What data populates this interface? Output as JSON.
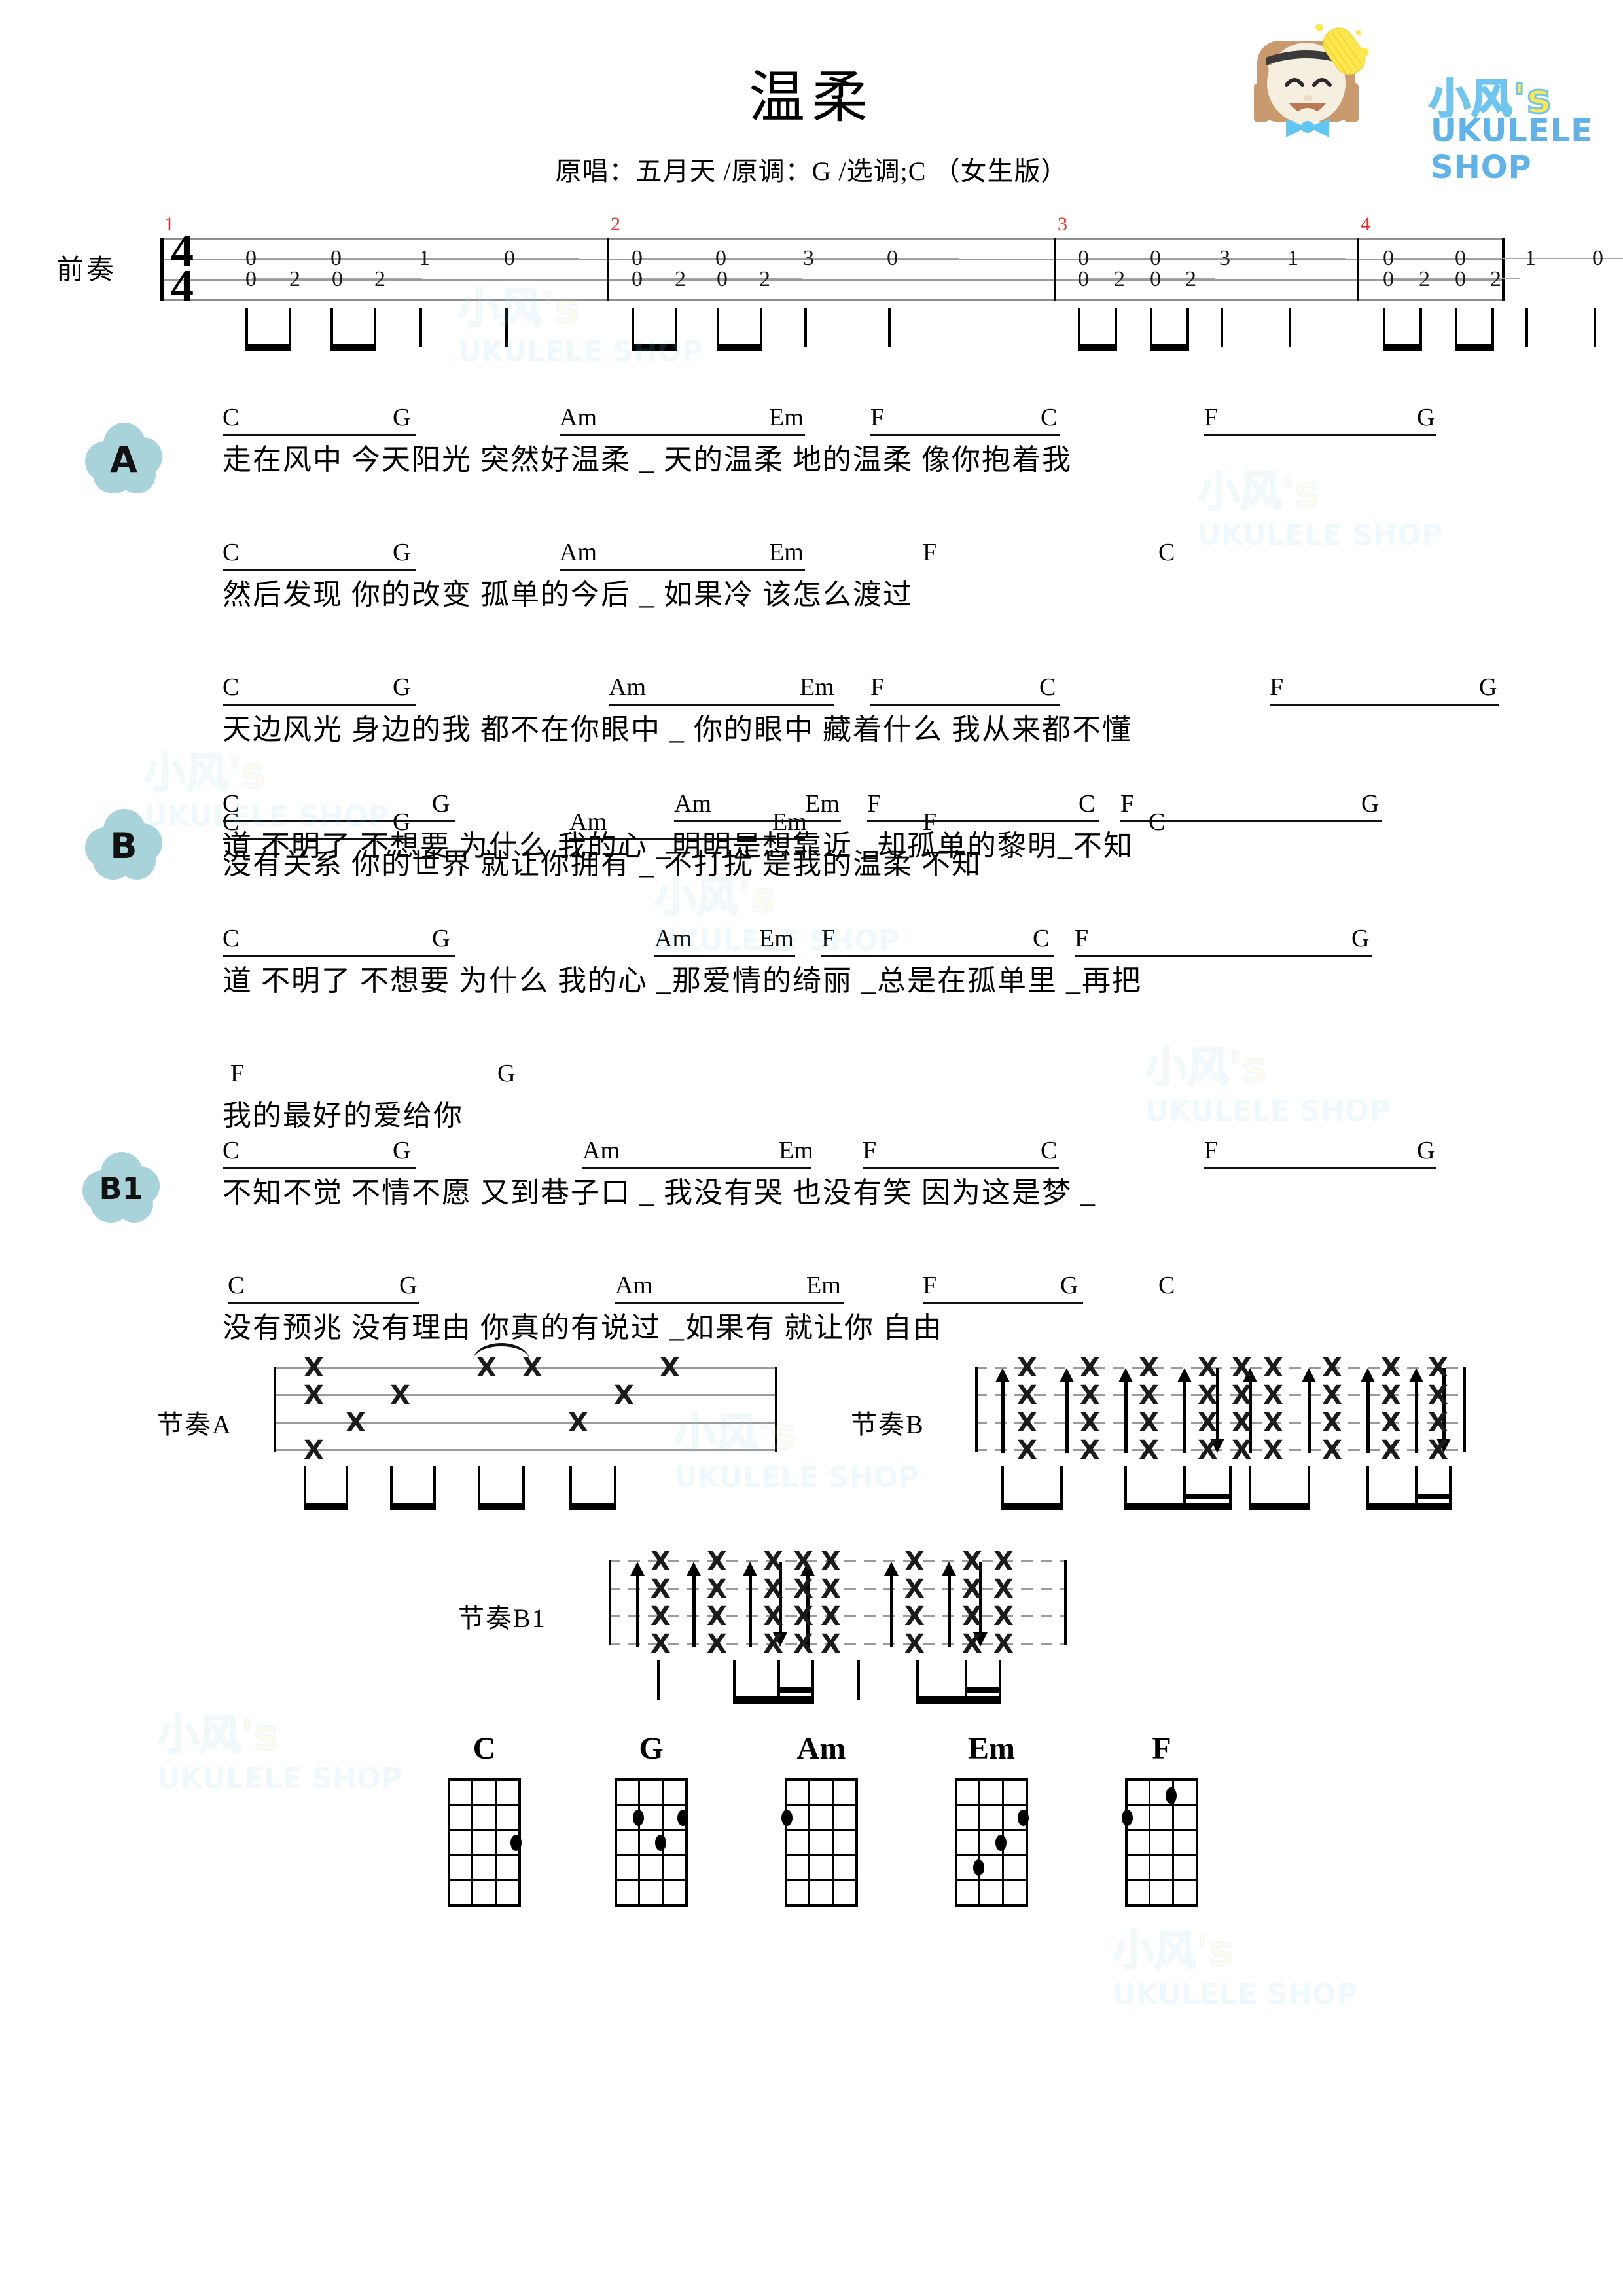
{
  "header": {
    "title": "温柔",
    "subtitle": "原唱：五月天  /原调：G  /选调;C  （女生版）"
  },
  "logo": {
    "brand_cn": "小风's",
    "brand_en": "UKULELE SHOP",
    "icon": "girl-avatar-icon"
  },
  "prelude": {
    "label": "前奏",
    "time_signature": "4/4",
    "measure_numbers": [
      "1",
      "2",
      "3",
      "4"
    ],
    "measures": [
      {
        "num": "1",
        "upper": [
          "0",
          "0",
          "1",
          "0"
        ],
        "lower": [
          "0",
          "2",
          "0",
          "2"
        ]
      },
      {
        "num": "2",
        "upper": [
          "0",
          "0",
          "3",
          "0"
        ],
        "lower": [
          "0",
          "2",
          "0",
          "2"
        ]
      },
      {
        "num": "3",
        "upper": [
          "0",
          "0",
          "3",
          "1"
        ],
        "lower": [
          "0",
          "2",
          "0",
          "2"
        ]
      },
      {
        "num": "4",
        "upper": [
          "0",
          "0",
          "1",
          "0"
        ],
        "lower": [
          "0",
          "2",
          "0",
          "2"
        ]
      }
    ]
  },
  "sections": [
    {
      "marker": "A",
      "lines": [
        {
          "chords": [
            "C",
            "G",
            "Am",
            "Em",
            "F",
            "C",
            "F",
            "G"
          ],
          "lyrics": "走在风中 今天阳光 突然好温柔  _     天的温柔 地的温柔 像你抱着我"
        },
        {
          "chords": [
            "C",
            "G",
            "Am",
            "Em",
            "F",
            "C"
          ],
          "lyrics": "然后发现 你的改变 孤单的今后  _   如果冷 该怎么渡过"
        },
        {
          "chords": [
            "C",
            "G",
            "Am",
            "Em",
            "F",
            "C",
            "F",
            "G"
          ],
          "lyrics": "天边风光 身边的我 都不在你眼中 _  你的眼中 藏着什么 我从来都不懂"
        },
        {
          "chords": [
            "C",
            "G",
            "Am",
            "Em",
            "F",
            "C"
          ],
          "lyrics": "没有关系 你的世界 就让你拥有  _   不打扰 是我的温柔    不知"
        }
      ]
    },
    {
      "marker": "B",
      "lines": [
        {
          "chords": [
            "C",
            "G",
            "Am",
            "Em",
            "F",
            "C",
            "F",
            "G"
          ],
          "lyrics": "道 不明了 不想要 为什么 我的心  _明明是想靠近  _却孤单的黎明_不知"
        },
        {
          "chords": [
            "C",
            "G",
            "Am",
            "Em",
            "F",
            "C",
            "F",
            "G"
          ],
          "lyrics": "道 不明了 不想要 为什么 我的心 _那爱情的绮丽 _总是在孤单里 _再把"
        },
        {
          "chords": [
            "F",
            "G"
          ],
          "lyrics": "我的最好的爱给你"
        }
      ]
    },
    {
      "marker": "B1",
      "lines": [
        {
          "chords": [
            "C",
            "G",
            "Am",
            "Em",
            "F",
            "C",
            "F",
            "G"
          ],
          "lyrics": "不知不觉 不情不愿 又到巷子口  _   我没有哭 也没有笑 因为这是梦  _"
        },
        {
          "chords": [
            "C",
            "G",
            "Am",
            "Em",
            "F",
            "G",
            "C"
          ],
          "lyrics": "没有预兆 没有理由 你真的有说过 _如果有 就让你 自由"
        }
      ]
    }
  ],
  "rhythms": [
    {
      "label": "节奏A",
      "name": "rhythm-a"
    },
    {
      "label": "节奏B",
      "name": "rhythm-b"
    },
    {
      "label": "节奏B1",
      "name": "rhythm-b1"
    }
  ],
  "chord_diagrams": [
    {
      "name": "C",
      "dots": [
        {
          "string": 1,
          "fret": 3
        }
      ]
    },
    {
      "name": "G",
      "dots": [
        {
          "string": 3,
          "fret": 2
        },
        {
          "string": 1,
          "fret": 2
        },
        {
          "string": 2,
          "fret": 3
        }
      ]
    },
    {
      "name": "Am",
      "dots": [
        {
          "string": 4,
          "fret": 2
        }
      ]
    },
    {
      "name": "Em",
      "dots": [
        {
          "string": 1,
          "fret": 2
        },
        {
          "string": 2,
          "fret": 3
        },
        {
          "string": 3,
          "fret": 4
        }
      ]
    },
    {
      "name": "F",
      "dots": [
        {
          "string": 2,
          "fret": 1
        },
        {
          "string": 4,
          "fret": 2
        }
      ]
    }
  ],
  "colors": {
    "measure_number": "#ee2b2b",
    "cloud": "#a8d3db",
    "brand_yellow": "#ffe84d",
    "brand_blue": "#5fb3e8"
  }
}
